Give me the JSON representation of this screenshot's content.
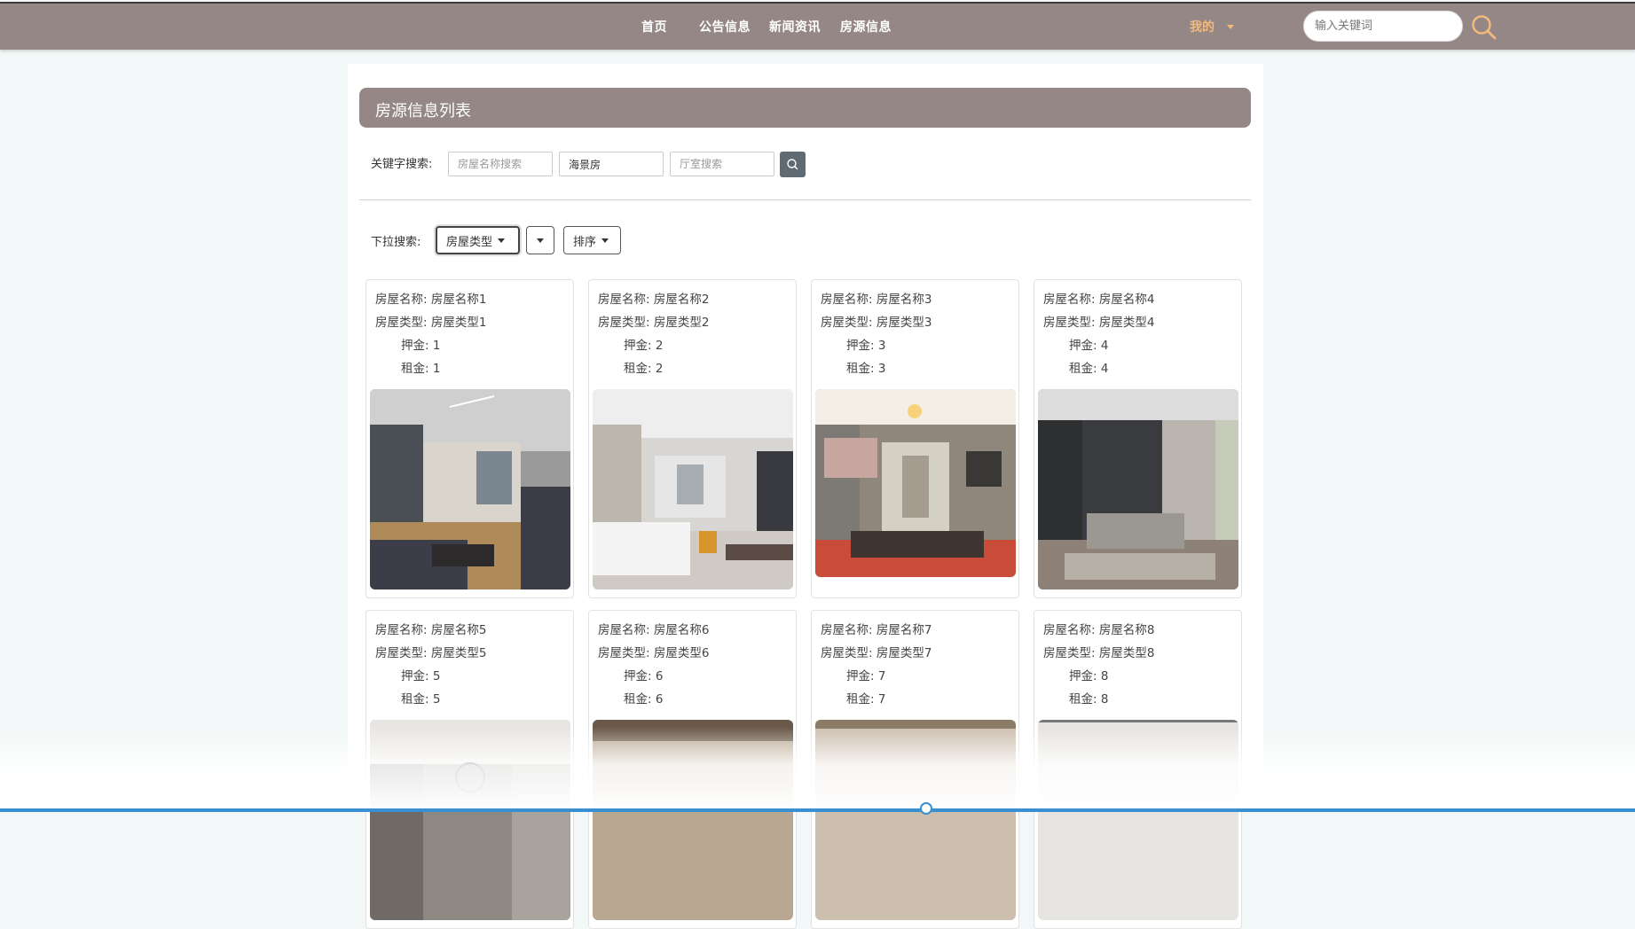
{
  "nav": {
    "items": [
      "首页",
      "公告信息",
      "新闻资讯",
      "房源信息"
    ],
    "my_label": "我的",
    "search_placeholder": "输入关键词"
  },
  "list": {
    "title": "房源信息列表",
    "keyword_label": "关键字搜索:",
    "name_placeholder": "房屋名称搜索",
    "type_value": "海景房",
    "hall_placeholder": "厅室搜索",
    "dropdown_label": "下拉搜索:",
    "house_type_btn": "房屋类型",
    "sort_btn": "排序"
  },
  "card_labels": {
    "name": "房屋名称:",
    "type": "房屋类型:",
    "deposit": "押金:",
    "rent": "租金:"
  },
  "houses": [
    {
      "name": "房屋名称1",
      "type": "房屋类型1",
      "deposit": "1",
      "rent": "1"
    },
    {
      "name": "房屋名称2",
      "type": "房屋类型2",
      "deposit": "2",
      "rent": "2"
    },
    {
      "name": "房屋名称3",
      "type": "房屋类型3",
      "deposit": "3",
      "rent": "3"
    },
    {
      "name": "房屋名称4",
      "type": "房屋类型4",
      "deposit": "4",
      "rent": "4"
    },
    {
      "name": "房屋名称5",
      "type": "房屋类型5",
      "deposit": "5",
      "rent": "5"
    },
    {
      "name": "房屋名称6",
      "type": "房屋类型6",
      "deposit": "6",
      "rent": "6"
    },
    {
      "name": "房屋名称7",
      "type": "房屋类型7",
      "deposit": "7",
      "rent": "7"
    },
    {
      "name": "房屋名称8",
      "type": "房屋类型8",
      "deposit": "8",
      "rent": "8"
    }
  ],
  "colors": {
    "header_bar": "#958786",
    "accent_my": "#f2b97a",
    "search_button": "#5f6a72",
    "page_bg": "#f2f8f7"
  }
}
